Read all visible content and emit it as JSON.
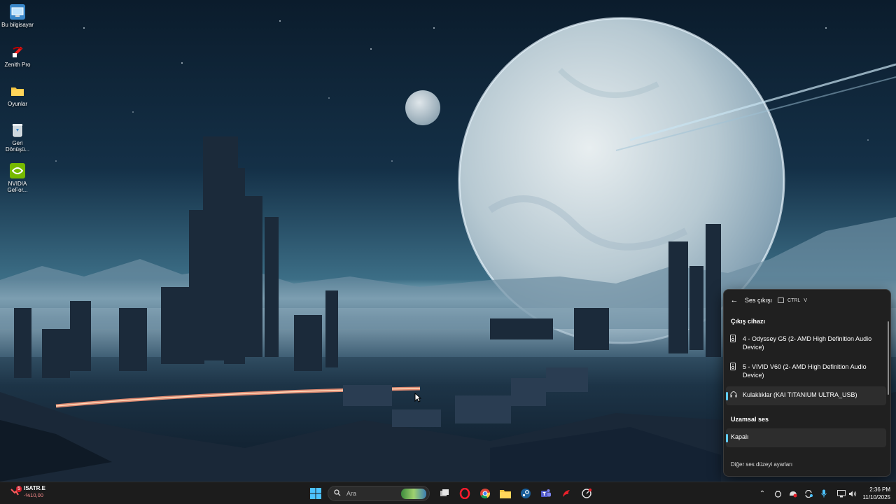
{
  "desktop": {
    "icons": [
      {
        "label": "Bu bilgisayar",
        "icon": "computer-icon"
      },
      {
        "label": "Zenith Pro",
        "icon": "zenith-app-icon"
      },
      {
        "label": "Oyunlar",
        "icon": "folder-icon"
      },
      {
        "label": "Geri Dönüşü...",
        "icon": "recycle-bin-icon"
      },
      {
        "label": "NVIDIA GeFor...",
        "icon": "nvidia-icon"
      }
    ]
  },
  "audio_flyout": {
    "title": "Ses çıkışı",
    "shortcut_ctrl": "CTRL",
    "shortcut_key": "V",
    "output_heading": "Çıkış cihazı",
    "devices": [
      {
        "label": "4 - Odyssey G5 (2- AMD High Definition Audio Device)",
        "icon": "speaker-icon",
        "selected": false
      },
      {
        "label": "5 - VIVID V60 (2- AMD High Definition Audio Device)",
        "icon": "speaker-icon",
        "selected": false
      },
      {
        "label": "Kulaklıklar (KAI TITANIUM ULTRA_USB)",
        "icon": "headphones-icon",
        "selected": true
      }
    ],
    "spatial_heading": "Uzamsal ses",
    "spatial_option": "Kapalı",
    "more_settings": "Diğer ses düzeyi ayarları"
  },
  "taskbar": {
    "stock_widget": {
      "badge": "5",
      "symbol": "ISATR.E",
      "change": "-%10,00"
    },
    "search": {
      "placeholder": "Ara"
    },
    "pinned_apps": [
      "start-icon",
      "task-view-icon",
      "opera-icon",
      "chrome-icon",
      "file-explorer-icon",
      "steam-icon",
      "teams-icon",
      "app-red-icon",
      "app-settings-icon"
    ],
    "tray_icons": [
      "chevron-up-icon",
      "tray-app-icon",
      "tray-red-app-icon",
      "sync-icon",
      "microphone-icon",
      "network-icon",
      "volume-icon"
    ],
    "clock": {
      "time": "2:36 PM",
      "date": "11/10/2025"
    }
  },
  "colors": {
    "accent": "#60cdff",
    "flyout_bg": "#202020",
    "taskbar_bg": "#1c1c1c"
  }
}
